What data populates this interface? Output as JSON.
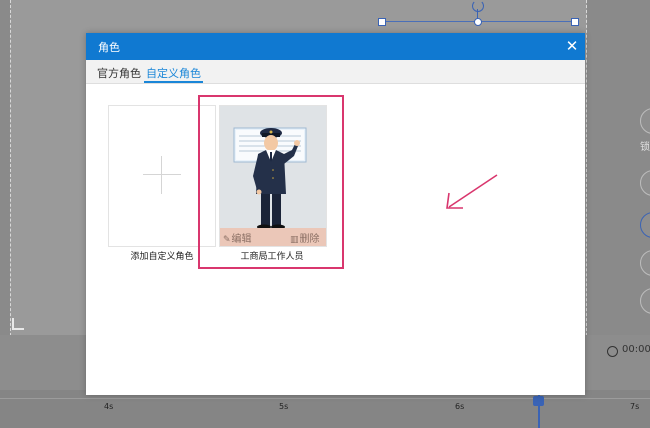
{
  "dialog": {
    "title": "角色",
    "close_glyph": "✕",
    "tabs": [
      {
        "label": "官方角色",
        "active": false
      },
      {
        "label": "自定义角色",
        "active": true
      }
    ],
    "cards": {
      "add_label": "添加自定义角色",
      "role_name": "工商局工作人员",
      "edit_label": "编辑",
      "delete_label": "删除"
    }
  },
  "editor": {
    "right_panel_label": "锁",
    "time_display": "00:00",
    "timeline_ticks": [
      "4s",
      "5s",
      "6s",
      "7s"
    ]
  },
  "colors": {
    "header": "#1079d1",
    "accent": "#1a86d8",
    "highlight": "#d9366e"
  }
}
